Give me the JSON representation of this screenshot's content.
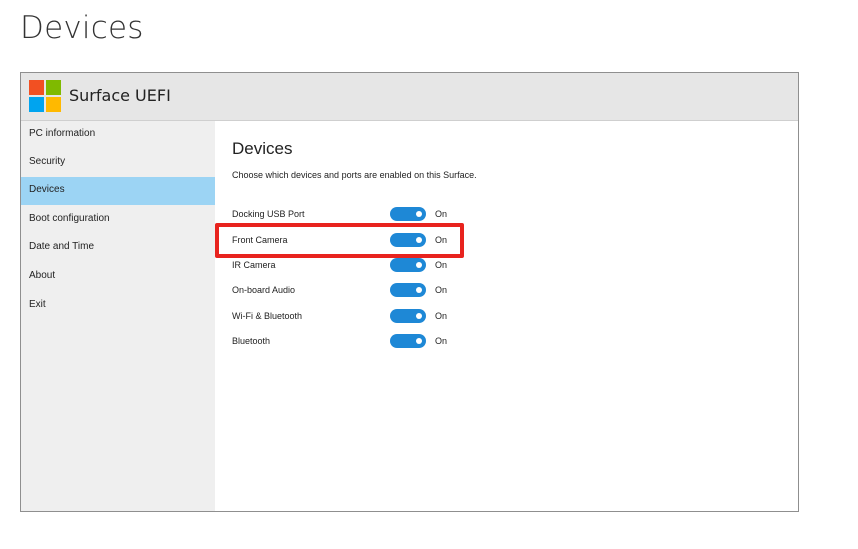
{
  "page": {
    "heading": "Devices"
  },
  "window": {
    "title": "Surface UEFI"
  },
  "sidebar": {
    "items": [
      {
        "label": "PC information",
        "active": false
      },
      {
        "label": "Security",
        "active": false
      },
      {
        "label": "Devices",
        "active": true
      },
      {
        "label": "Boot configuration",
        "active": false
      },
      {
        "label": "Date and Time",
        "active": false
      },
      {
        "label": "About",
        "active": false
      },
      {
        "label": "Exit",
        "active": false
      }
    ]
  },
  "content": {
    "title": "Devices",
    "description": "Choose which devices and ports are enabled on this Surface.",
    "devices": [
      {
        "label": "Docking USB Port",
        "state": "On"
      },
      {
        "label": "Front Camera",
        "state": "On",
        "highlighted": true
      },
      {
        "label": "IR Camera",
        "state": "On"
      },
      {
        "label": "On-board Audio",
        "state": "On"
      },
      {
        "label": "Wi-Fi & Bluetooth",
        "state": "On"
      },
      {
        "label": "Bluetooth",
        "state": "On"
      }
    ]
  },
  "colors": {
    "accent": "#1e88d6",
    "active_nav": "#9cd4f4",
    "highlight_box": "#e8231e"
  }
}
